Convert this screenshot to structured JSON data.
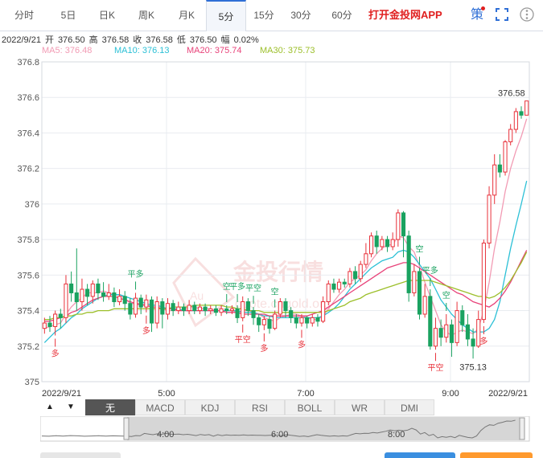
{
  "tabs": [
    {
      "label": "分时"
    },
    {
      "label": "5日"
    },
    {
      "label": "日K"
    },
    {
      "label": "周K"
    },
    {
      "label": "月K"
    },
    {
      "label": "5分"
    },
    {
      "label": "15分"
    },
    {
      "label": "30分"
    },
    {
      "label": "60分"
    }
  ],
  "active_tab": "5分",
  "app_link": "打开金投网APP",
  "strategy_label": "策",
  "icons": {
    "fullscreen": "fullscreen-icon",
    "more": "more-icon"
  },
  "info": {
    "date": "2022/9/21",
    "open_label": "开",
    "open": "376.50",
    "high_label": "高",
    "high": "376.58",
    "close_label": "收",
    "close": "376.58",
    "low_label": "低",
    "low": "376.50",
    "amp_label": "幅",
    "amp": "0.02%"
  },
  "ma": [
    {
      "label": "MA5: 376.48",
      "color": "#f29bb4"
    },
    {
      "label": "MA10: 376.13",
      "color": "#2cc0d6"
    },
    {
      "label": "MA20: 375.74",
      "color": "#e8437a"
    },
    {
      "label": "MA30: 375.73",
      "color": "#9cbf2a"
    }
  ],
  "watermark": {
    "brand": "金投行情",
    "url": "quote.cngold.org",
    "logo": "Au"
  },
  "indicators": [
    {
      "label": "无"
    },
    {
      "label": "MACD"
    },
    {
      "label": "KDJ"
    },
    {
      "label": "RSI"
    },
    {
      "label": "BOLL"
    },
    {
      "label": "WR"
    },
    {
      "label": "DMI"
    }
  ],
  "nav_arrows": {
    "left": "▲",
    "right": "▼"
  },
  "navigator_labels": [
    "4:00",
    "6:00",
    "8:00"
  ],
  "colors": {
    "up": "#e8313a",
    "down": "#1aa260",
    "grid": "#e9ecf0"
  },
  "chart_data": {
    "type": "candlestick",
    "ylim": [
      375,
      376.8
    ],
    "y_ticks": [
      "376.8",
      "376.6",
      "376.4",
      "376.2",
      "376",
      "375.8",
      "375.6",
      "375.4",
      "375.2",
      "375"
    ],
    "x_ticks": [
      "2022/9/21",
      "5:00",
      "7:00",
      "9:00",
      "2022/9/21"
    ],
    "annotations": {
      "max": "376.58",
      "min": "375.13"
    },
    "markers": [
      {
        "text": "多",
        "dir": "up"
      },
      {
        "text": "平多",
        "dir": "down"
      },
      {
        "text": "多",
        "dir": "up"
      },
      {
        "text": "空",
        "dir": "down"
      },
      {
        "text": "平多",
        "dir": "down"
      },
      {
        "text": "平空",
        "dir": "up"
      },
      {
        "text": "平空",
        "dir": "down"
      },
      {
        "text": "多",
        "dir": "up"
      },
      {
        "text": "空",
        "dir": "down"
      },
      {
        "text": "多",
        "dir": "up"
      },
      {
        "text": "空",
        "dir": "down"
      },
      {
        "text": "平多",
        "dir": "down"
      },
      {
        "text": "平空",
        "dir": "up"
      },
      {
        "text": "空",
        "dir": "down"
      },
      {
        "text": "多",
        "dir": "up"
      }
    ],
    "candles": [
      [
        375.3,
        375.33,
        375.36,
        375.27
      ],
      [
        375.33,
        375.31,
        375.37,
        375.28
      ],
      [
        375.31,
        375.38,
        375.4,
        375.26
      ],
      [
        375.38,
        375.36,
        375.41,
        375.3
      ],
      [
        375.36,
        375.55,
        375.6,
        375.33
      ],
      [
        375.55,
        375.5,
        375.62,
        375.45
      ],
      [
        375.5,
        375.45,
        375.75,
        375.4
      ],
      [
        375.45,
        375.52,
        375.58,
        375.4
      ],
      [
        375.52,
        375.48,
        375.55,
        375.43
      ],
      [
        375.48,
        375.55,
        375.57,
        375.44
      ],
      [
        375.55,
        375.5,
        375.58,
        375.46
      ],
      [
        375.5,
        375.48,
        375.56,
        375.45
      ],
      [
        375.48,
        375.5,
        375.55,
        375.46
      ],
      [
        375.5,
        375.45,
        375.53,
        375.42
      ],
      [
        375.45,
        375.48,
        375.52,
        375.43
      ],
      [
        375.48,
        375.44,
        375.51,
        375.4
      ],
      [
        375.44,
        375.38,
        375.47,
        375.35
      ],
      [
        375.38,
        375.47,
        375.5,
        375.36
      ],
      [
        375.47,
        375.42,
        375.49,
        375.38
      ],
      [
        375.42,
        375.46,
        375.49,
        375.39
      ],
      [
        375.46,
        375.33,
        375.48,
        375.28
      ],
      [
        375.33,
        375.45,
        375.48,
        375.3
      ],
      [
        375.45,
        375.38,
        375.47,
        375.3
      ],
      [
        375.38,
        375.44,
        375.47,
        375.35
      ],
      [
        375.44,
        375.4,
        375.46,
        375.37
      ],
      [
        375.4,
        375.42,
        375.45,
        375.38
      ],
      [
        375.42,
        375.4,
        375.44,
        375.37
      ],
      [
        375.4,
        375.43,
        375.46,
        375.38
      ],
      [
        375.43,
        375.4,
        375.45,
        375.38
      ],
      [
        375.4,
        375.42,
        375.44,
        375.38
      ],
      [
        375.42,
        375.4,
        375.44,
        375.37
      ],
      [
        375.4,
        375.41,
        375.43,
        375.38
      ],
      [
        375.41,
        375.39,
        375.43,
        375.37
      ],
      [
        375.39,
        375.41,
        375.43,
        375.37
      ],
      [
        375.41,
        375.4,
        375.43,
        375.38
      ],
      [
        375.4,
        375.41,
        375.43,
        375.38
      ],
      [
        375.41,
        375.36,
        375.43,
        375.33
      ],
      [
        375.36,
        375.45,
        375.48,
        375.34
      ],
      [
        375.45,
        375.4,
        375.47,
        375.37
      ],
      [
        375.4,
        375.36,
        375.42,
        375.32
      ],
      [
        375.36,
        375.32,
        375.38,
        375.28
      ],
      [
        375.32,
        375.35,
        375.37,
        375.29
      ],
      [
        375.35,
        375.3,
        375.37,
        375.27
      ],
      [
        375.3,
        375.38,
        375.4,
        375.29
      ],
      [
        375.38,
        375.45,
        375.47,
        375.36
      ],
      [
        375.45,
        375.4,
        375.47,
        375.36
      ],
      [
        375.4,
        375.36,
        375.42,
        375.33
      ],
      [
        375.36,
        375.33,
        375.38,
        375.3
      ],
      [
        375.33,
        375.36,
        375.38,
        375.31
      ],
      [
        375.36,
        375.33,
        375.37,
        375.3
      ],
      [
        375.33,
        375.36,
        375.38,
        375.31
      ],
      [
        375.36,
        375.34,
        375.38,
        375.31
      ],
      [
        375.34,
        375.45,
        375.48,
        375.33
      ],
      [
        375.45,
        375.55,
        375.57,
        375.43
      ],
      [
        375.55,
        375.52,
        375.58,
        375.5
      ],
      [
        375.52,
        375.56,
        375.58,
        375.5
      ],
      [
        375.56,
        375.55,
        375.58,
        375.53
      ],
      [
        375.55,
        375.62,
        375.64,
        375.53
      ],
      [
        375.62,
        375.58,
        375.65,
        375.55
      ],
      [
        375.58,
        375.66,
        375.68,
        375.56
      ],
      [
        375.66,
        375.72,
        375.78,
        375.64
      ],
      [
        375.72,
        375.82,
        375.84,
        375.7
      ],
      [
        375.82,
        375.76,
        375.85,
        375.72
      ],
      [
        375.76,
        375.8,
        375.82,
        375.74
      ],
      [
        375.8,
        375.76,
        375.82,
        375.73
      ],
      [
        375.76,
        375.8,
        375.84,
        375.74
      ],
      [
        375.8,
        375.95,
        375.97,
        375.76
      ],
      [
        375.95,
        375.82,
        375.96,
        375.7
      ],
      [
        375.82,
        375.5,
        375.85,
        375.45
      ],
      [
        375.5,
        375.62,
        375.66,
        375.48
      ],
      [
        375.62,
        375.38,
        375.64,
        375.35
      ],
      [
        375.38,
        375.48,
        375.55,
        375.36
      ],
      [
        375.48,
        375.2,
        375.52,
        375.18
      ],
      [
        375.2,
        375.3,
        375.36,
        375.18
      ],
      [
        375.3,
        375.25,
        375.35,
        375.2
      ],
      [
        375.25,
        375.32,
        375.38,
        375.22
      ],
      [
        375.32,
        375.22,
        375.35,
        375.14
      ],
      [
        375.22,
        375.4,
        375.45,
        375.2
      ],
      [
        375.4,
        375.32,
        375.43,
        375.28
      ],
      [
        375.32,
        375.24,
        375.38,
        375.2
      ],
      [
        375.24,
        375.2,
        375.3,
        375.13
      ],
      [
        375.2,
        375.35,
        375.4,
        375.19
      ],
      [
        375.35,
        375.78,
        375.8,
        375.33
      ],
      [
        375.78,
        376.05,
        376.1,
        375.75
      ],
      [
        376.05,
        376.22,
        376.28,
        376.0
      ],
      [
        376.22,
        376.18,
        376.28,
        376.15
      ],
      [
        376.18,
        376.35,
        376.36,
        376.16
      ],
      [
        376.35,
        376.42,
        376.45,
        376.33
      ],
      [
        376.42,
        376.52,
        376.54,
        376.4
      ],
      [
        376.52,
        376.5,
        376.55,
        376.48
      ],
      [
        376.5,
        376.58,
        376.58,
        376.5
      ]
    ],
    "series": [
      {
        "name": "MA5",
        "color": "#f29bb4",
        "values": [
          375.3,
          375.31,
          375.32,
          375.33,
          375.38,
          375.42,
          375.45,
          375.47,
          375.5,
          375.5,
          375.5,
          375.51,
          375.5,
          375.49,
          375.49,
          375.47,
          375.44,
          375.44,
          375.44,
          375.43,
          375.42,
          375.42,
          375.41,
          375.4,
          375.4,
          375.4,
          375.4,
          375.42,
          375.42,
          375.41,
          375.41,
          375.41,
          375.4,
          375.4,
          375.4,
          375.4,
          375.39,
          375.4,
          375.4,
          375.39,
          375.38,
          375.36,
          375.35,
          375.34,
          375.36,
          375.37,
          375.38,
          375.38,
          375.37,
          375.36,
          375.35,
          375.35,
          375.37,
          375.41,
          375.45,
          375.49,
          375.52,
          375.56,
          375.58,
          375.6,
          375.63,
          375.68,
          375.72,
          375.75,
          375.77,
          375.77,
          375.82,
          375.81,
          375.76,
          375.73,
          375.65,
          375.56,
          375.48,
          375.4,
          375.32,
          375.28,
          375.26,
          375.28,
          375.29,
          375.28,
          375.27,
          375.3,
          375.4,
          375.56,
          375.75,
          375.9,
          376.07,
          376.2,
          376.3,
          376.38,
          376.48
        ]
      },
      {
        "name": "MA10",
        "color": "#2cc0d6",
        "values": [
          375.22,
          375.25,
          375.28,
          375.3,
          375.33,
          375.36,
          375.38,
          375.41,
          375.43,
          375.45,
          375.47,
          375.48,
          375.49,
          375.49,
          375.49,
          375.48,
          375.47,
          375.46,
          375.45,
          375.44,
          375.43,
          375.43,
          375.42,
          375.41,
          375.41,
          375.41,
          375.4,
          375.4,
          375.4,
          375.4,
          375.4,
          375.4,
          375.4,
          375.4,
          375.4,
          375.4,
          375.4,
          375.39,
          375.39,
          375.39,
          375.38,
          375.37,
          375.37,
          375.36,
          375.36,
          375.36,
          375.36,
          375.36,
          375.36,
          375.36,
          375.36,
          375.36,
          375.37,
          375.39,
          375.41,
          375.44,
          375.48,
          375.52,
          375.55,
          375.58,
          375.61,
          375.64,
          375.66,
          375.68,
          375.69,
          375.7,
          375.73,
          375.74,
          375.73,
          375.7,
          375.66,
          375.62,
          375.58,
          375.52,
          375.46,
          375.42,
          375.38,
          375.35,
          375.32,
          375.3,
          375.28,
          375.28,
          375.28,
          375.3,
          375.35,
          375.45,
          375.6,
          375.75,
          375.88,
          376.0,
          376.13
        ]
      },
      {
        "name": "MA20",
        "color": "#e8437a",
        "values": [
          375.34,
          375.34,
          375.35,
          375.36,
          375.37,
          375.39,
          375.4,
          375.42,
          375.44,
          375.46,
          375.47,
          375.48,
          375.48,
          375.48,
          375.47,
          375.46,
          375.45,
          375.44,
          375.43,
          375.43,
          375.42,
          375.42,
          375.41,
          375.41,
          375.41,
          375.4,
          375.4,
          375.4,
          375.4,
          375.4,
          375.4,
          375.4,
          375.4,
          375.4,
          375.39,
          375.39,
          375.39,
          375.38,
          375.38,
          375.38,
          375.38,
          375.38,
          375.37,
          375.37,
          375.37,
          375.37,
          375.37,
          375.37,
          375.37,
          375.37,
          375.38,
          375.39,
          375.4,
          375.42,
          375.44,
          375.46,
          375.48,
          375.5,
          375.52,
          375.54,
          375.56,
          375.58,
          375.6,
          375.62,
          375.64,
          375.65,
          375.66,
          375.67,
          375.67,
          375.66,
          375.64,
          375.62,
          375.6,
          375.58,
          375.56,
          375.54,
          375.52,
          375.5,
          375.49,
          375.47,
          375.45,
          375.44,
          375.43,
          375.42,
          375.44,
          375.47,
          375.51,
          375.56,
          375.62,
          375.68,
          375.74
        ]
      },
      {
        "name": "MA30",
        "color": "#9cbf2a",
        "values": [
          375.35,
          375.35,
          375.36,
          375.36,
          375.37,
          375.37,
          375.38,
          375.38,
          375.39,
          375.39,
          375.4,
          375.4,
          375.4,
          375.41,
          375.41,
          375.41,
          375.41,
          375.41,
          375.41,
          375.41,
          375.41,
          375.41,
          375.41,
          375.41,
          375.42,
          375.42,
          375.42,
          375.42,
          375.43,
          375.43,
          375.43,
          375.43,
          375.43,
          375.43,
          375.42,
          375.42,
          375.41,
          375.41,
          375.4,
          375.4,
          375.4,
          375.39,
          375.39,
          375.39,
          375.39,
          375.39,
          375.39,
          375.39,
          375.39,
          375.39,
          375.39,
          375.39,
          375.39,
          375.4,
          375.41,
          375.42,
          375.43,
          375.45,
          375.46,
          375.47,
          375.49,
          375.5,
          375.51,
          375.52,
          375.53,
          375.54,
          375.55,
          375.56,
          375.57,
          375.57,
          375.57,
          375.57,
          375.57,
          375.56,
          375.55,
          375.54,
          375.53,
          375.52,
          375.51,
          375.5,
          375.49,
          375.48,
          375.48,
          375.47,
          375.48,
          375.5,
          375.53,
          375.57,
          375.62,
          375.67,
          375.73
        ]
      }
    ]
  }
}
